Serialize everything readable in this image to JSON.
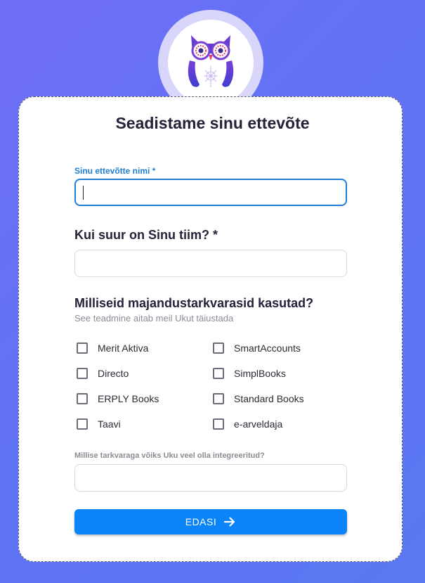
{
  "header": {
    "logo_icon": "owl-logo-icon"
  },
  "form": {
    "title": "Seadistame sinu ettevõte",
    "company_name": {
      "label": "Sinu ettevõtte nimi *",
      "value": ""
    },
    "team_size": {
      "heading": "Kui suur on Sinu tiim? *",
      "value": ""
    },
    "software": {
      "heading": "Milliseid majandustarkvarasid kasutad?",
      "subtext": "See teadmine aitab meil Ukut täiustada",
      "options_left": [
        "Merit Aktiva",
        "Directo",
        "ERPLY Books",
        "Taavi"
      ],
      "options_right": [
        "SmartAccounts",
        "SimplBooks",
        "Standard Books",
        "e-arveldaja"
      ]
    },
    "other_software": {
      "label": "Millise tarkvaraga võiks Uku veel olla integreeritud?",
      "value": ""
    },
    "submit": {
      "label": "EDASI",
      "icon": "arrow-right-icon"
    }
  },
  "colors": {
    "background": "#6a72f5",
    "accent": "#1f7fd4",
    "button": "#0a84f8",
    "logo_ring": "#d9d6fb"
  }
}
